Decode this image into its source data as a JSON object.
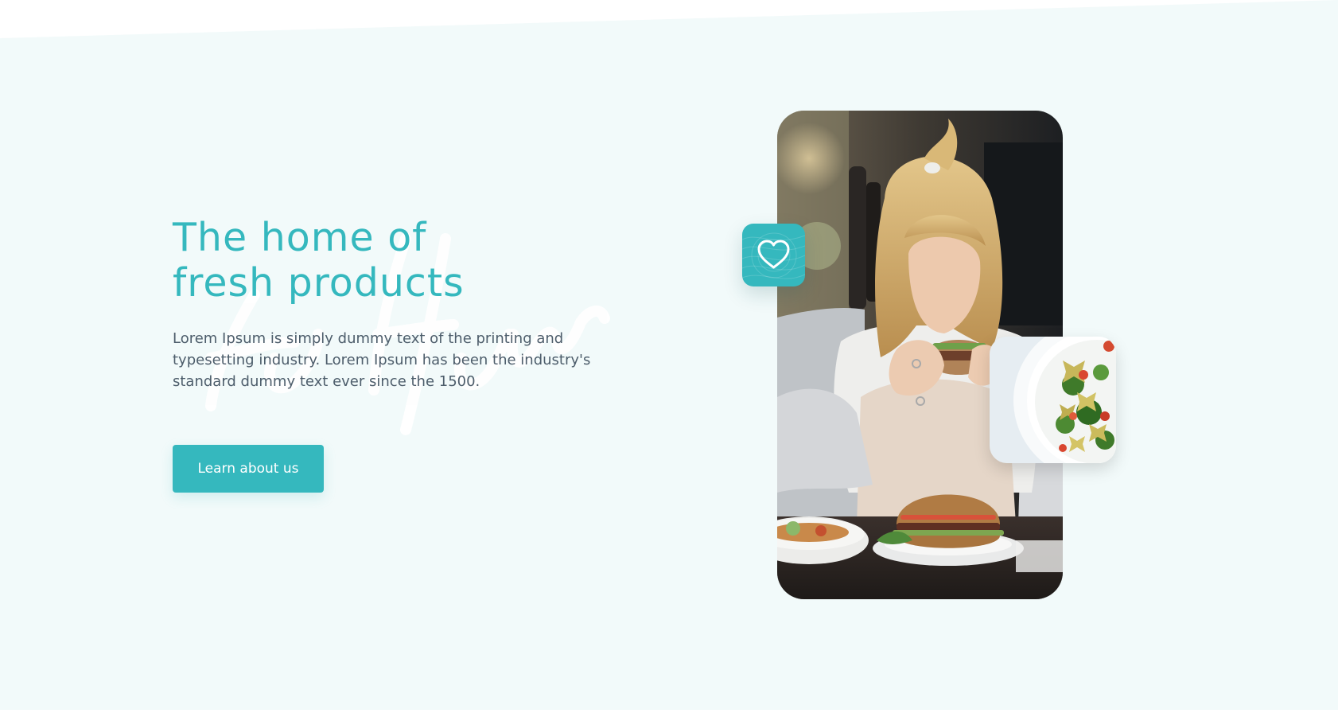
{
  "hero": {
    "title_line1": "The home of",
    "title_line2": "fresh products",
    "description": "Lorem Ipsum is simply dummy text of the printing and typesetting industry. Lorem Ipsum has been the industry's standard dummy text ever since the 1500.",
    "cta_label": "Learn about us"
  },
  "icons": {
    "badge": "heart-icon"
  },
  "colors": {
    "accent": "#35b8be",
    "background": "#f2fafa",
    "body_text": "#4d5d6b"
  }
}
